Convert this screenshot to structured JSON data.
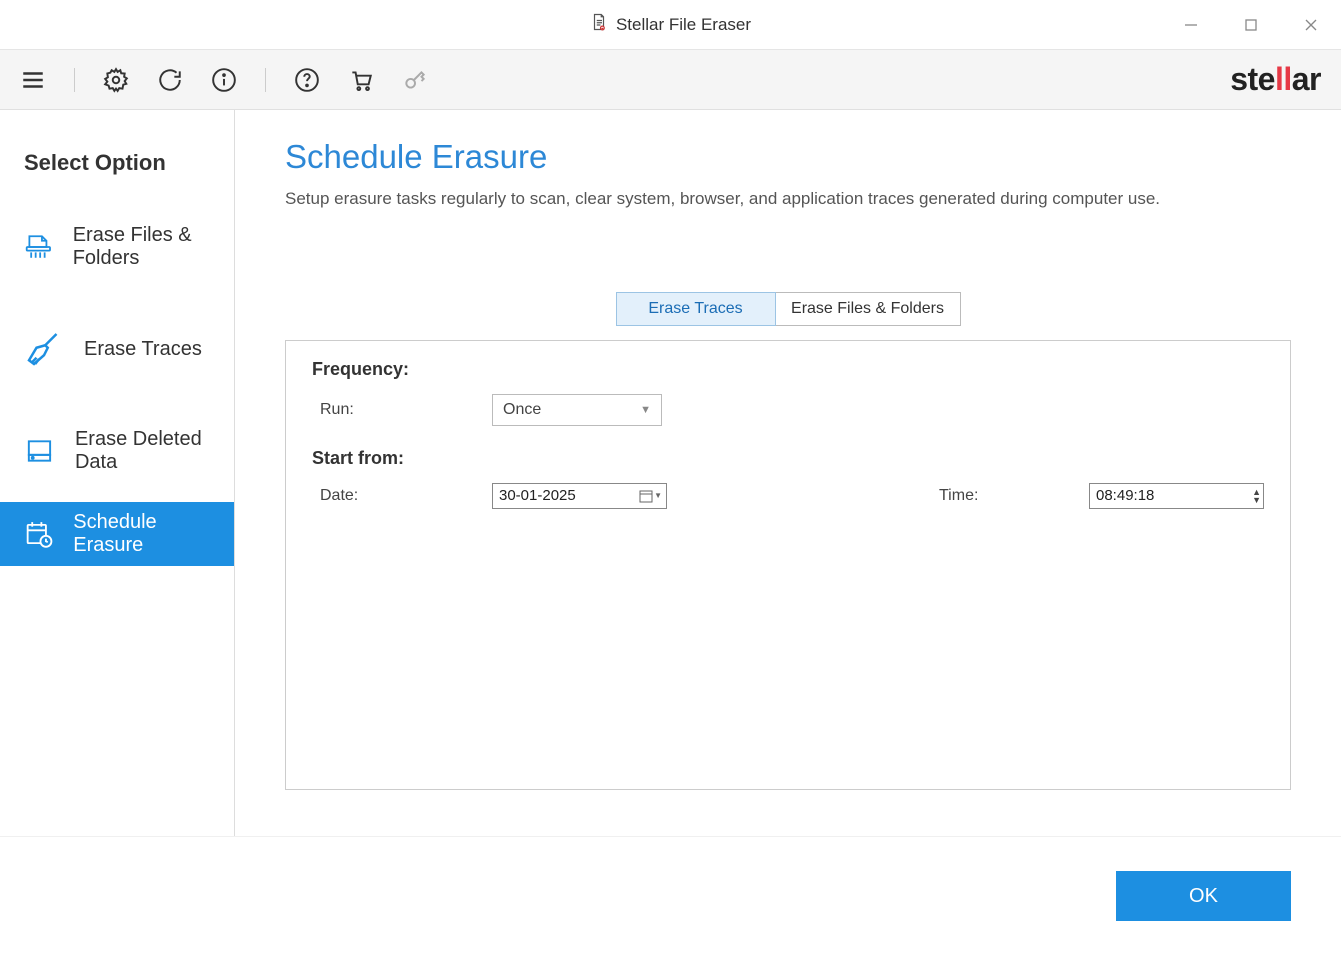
{
  "window": {
    "title": "Stellar File Eraser"
  },
  "brand": {
    "text_pre": "ste",
    "text_mid": "ll",
    "text_post": "ar"
  },
  "sidebar": {
    "title": "Select Option",
    "items": [
      {
        "label": "Erase Files & Folders"
      },
      {
        "label": "Erase Traces"
      },
      {
        "label": "Erase Deleted Data"
      },
      {
        "label": "Schedule Erasure"
      }
    ]
  },
  "page": {
    "title": "Schedule Erasure",
    "description": "Setup erasure tasks regularly to scan, clear system, browser, and application traces generated during computer use."
  },
  "tabs": {
    "t1": "Erase Traces",
    "t2": "Erase Files & Folders"
  },
  "form": {
    "frequency_heading": "Frequency:",
    "run_label": "Run:",
    "run_value": "Once",
    "start_heading": "Start from:",
    "date_label": "Date:",
    "date_value": "30-01-2025",
    "time_label": "Time:",
    "time_value": "08:49:18"
  },
  "footer": {
    "ok": "OK"
  }
}
